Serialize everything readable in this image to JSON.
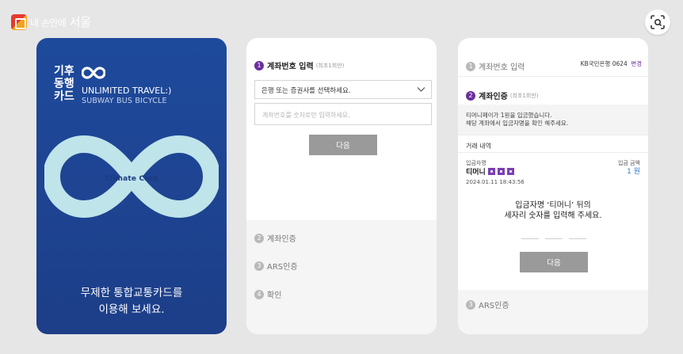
{
  "brand": {
    "line1": "내 손안에",
    "line2": "서울"
  },
  "card": {
    "title_lines": [
      "기후",
      "동행",
      "카드"
    ],
    "subtitle_en": "UNLIMITED TRAVEL:)",
    "subtitle_en2": "SUBWAY BUS BICYCLE",
    "center_text": "Climate Card",
    "caption_line1": "무제한 통합교통카드를",
    "caption_line2": "이용해 보세요."
  },
  "panel_account": {
    "step1": {
      "num": "1",
      "label": "계좌번호 입력",
      "note": "(최초1회만)"
    },
    "bank_select": "은행 또는 증권사를 선택하세요.",
    "account_placeholder": "계좌번호를 숫자로만 입력하세요.",
    "next_label": "다음",
    "step2": {
      "num": "2",
      "label": "계좌인증"
    },
    "step3": {
      "num": "3",
      "label": "ARS인증"
    },
    "step4": {
      "num": "4",
      "label": "확인"
    }
  },
  "panel_verify": {
    "step1": {
      "num": "1",
      "label": "계좌번호 입력"
    },
    "bank_info": "KB국민은행 0624",
    "change_label": "변경",
    "step2": {
      "num": "2",
      "label": "계좌인증",
      "note": "(최초1회만)"
    },
    "desc_line1": "티머니페이가 1원을 입금했습니다.",
    "desc_line2": "해당 계좌에서 입금자명을 확인 해주세요.",
    "tx_header": "거래 내역",
    "depositor_label": "입금자명",
    "depositor_name": "티머니",
    "amount_label": "입금 금액",
    "amount": "1 원",
    "tx_time": "2024.01.11 18:43:56",
    "prompt_line1": "입금자명 ‘티머니’ 뒤의",
    "prompt_line2": "세자리 숫자를 입력해 주세요.",
    "next_label": "다음",
    "step3": {
      "num": "3",
      "label": "ARS인증"
    }
  },
  "colors": {
    "accent": "#6a2f9d",
    "card_blue": "#1e4a9c",
    "infinity": "#bfe4ea",
    "button_grey": "#9a9a9a",
    "amount_blue": "#2f7ad6"
  },
  "icons": {
    "scan": "scan-icon",
    "chevron": "chevron-down-icon",
    "infinity": "infinity-icon"
  }
}
